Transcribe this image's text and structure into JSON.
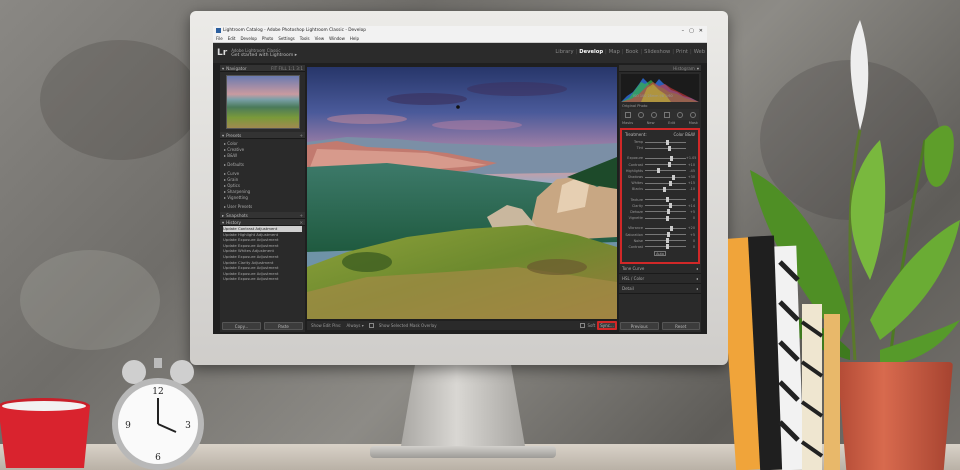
{
  "window": {
    "title": "Lightroom Catalog - Adobe Photoshop Lightroom Classic - Develop",
    "controls": [
      "–",
      "▢",
      "✕"
    ]
  },
  "menu": [
    "File",
    "Edit",
    "Develop",
    "Photo",
    "Settings",
    "Tools",
    "View",
    "Window",
    "Help"
  ],
  "identity": {
    "logo": "Lr",
    "line1": "Adobe Lightroom Classic",
    "line2": "Get started with Lightroom ▸"
  },
  "modules": [
    "Library",
    "Develop",
    "Map",
    "Book",
    "Slideshow",
    "Print",
    "Web"
  ],
  "active_module": "Develop",
  "left_panel": {
    "navigator": {
      "label": "Navigator",
      "zoom": "FIT  FILL  1:1  3:1"
    },
    "presets": {
      "label": "Presets",
      "items": [
        "▸ Color",
        "▸ Creative",
        "▸ B&W",
        "",
        "▸ Defaults",
        "",
        "▸ Curve",
        "▸ Grain",
        "▸ Optics",
        "▸ Sharpening",
        "▸ Vignetting"
      ]
    },
    "user_presets": "▸ User Presets",
    "snapshots": "Snapshots",
    "history": {
      "label": "History",
      "items": [
        "Update Contrast Adjustment",
        "Update Highlight Adjustment",
        "Update Exposure Adjustment",
        "Update Exposure Adjustment",
        "Update Whites Adjustment",
        "Update Exposure Adjustment",
        "Update Clarity Adjustment",
        "Update Exposure Adjustment",
        "Update Exposure Adjustment",
        "Update Exposure Adjustment"
      ]
    },
    "copy_label": "Copy...",
    "paste_label": "Paste"
  },
  "center_toolbar": {
    "show_label": "Show Edit Pins:",
    "show_value": "Always ▾",
    "overlay_label": "Show Selected Mask Overlay",
    "softproof_label": "Soft Proofing"
  },
  "right_panel": {
    "histogram_label": "Histogram",
    "original_photo": "Original Photo",
    "hist_values": "ISO 100   28mm   f/8   1/60",
    "mask_row": [
      "Masks",
      "New",
      "Edit",
      "Mask"
    ],
    "basic": {
      "head_left": "Treatment:",
      "head_right": "Color  B&W",
      "profile": "Profile: Adobe Color ▾",
      "groups": [
        [
          {
            "label": "Temp",
            "value": "",
            "pos": 0.5
          },
          {
            "label": "Tint",
            "value": "",
            "pos": 0.55
          }
        ],
        [
          {
            "label": "Exposure",
            "value": "+1.05",
            "pos": 0.62
          },
          {
            "label": "Contrast",
            "value": "+10",
            "pos": 0.56
          },
          {
            "label": "Highlights",
            "value": "-45",
            "pos": 0.3
          },
          {
            "label": "Shadows",
            "value": "+30",
            "pos": 0.66
          },
          {
            "label": "Whites",
            "value": "+15",
            "pos": 0.58
          },
          {
            "label": "Blacks",
            "value": "-10",
            "pos": 0.44
          }
        ],
        [
          {
            "label": "Texture",
            "value": "0",
            "pos": 0.5
          },
          {
            "label": "Clarity",
            "value": "+14",
            "pos": 0.58
          },
          {
            "label": "Dehaze",
            "value": "+5",
            "pos": 0.53
          },
          {
            "label": "Vignette",
            "value": "0",
            "pos": 0.5
          }
        ],
        [
          {
            "label": "Vibrance",
            "value": "+20",
            "pos": 0.6
          },
          {
            "label": "Saturation",
            "value": "+5",
            "pos": 0.53
          },
          {
            "label": "Noise",
            "value": "0",
            "pos": 0.5
          },
          {
            "label": "Contrast",
            "value": "0",
            "pos": 0.5
          }
        ]
      ],
      "auto_label": "Auto",
      "wb_label": "WB:",
      "tone_label": "Tone"
    },
    "tone_curve": "Tone Curve",
    "hsl": "HSL / Color",
    "detail": "Detail",
    "previous_label": "Previous",
    "reset_label": "Reset",
    "sync_label": "Sync..."
  }
}
